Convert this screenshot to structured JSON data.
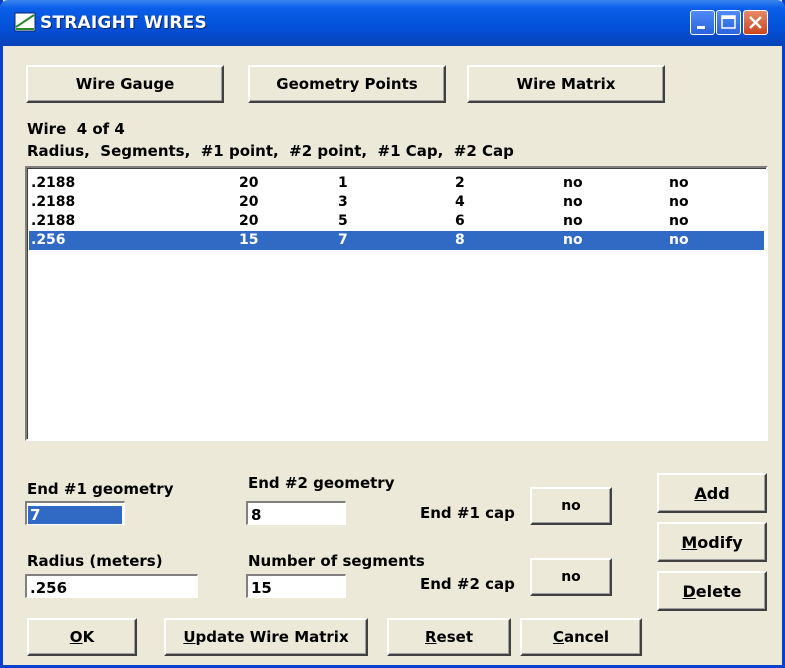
{
  "window": {
    "title": "STRAIGHT WIRES"
  },
  "top_buttons": {
    "wire_gauge": "Wire Gauge",
    "geometry_points": "Geometry Points",
    "wire_matrix": "Wire Matrix"
  },
  "wire_counter": "Wire  4 of 4",
  "list_header": "Radius,  Segments,  #1 point,  #2 point,  #1 Cap,  #2 Cap",
  "wires": [
    {
      "radius": ".2188",
      "segments": "20",
      "p1": "1",
      "p2": "2",
      "cap1": "no",
      "cap2": "no"
    },
    {
      "radius": ".2188",
      "segments": "20",
      "p1": "3",
      "p2": "4",
      "cap1": "no",
      "cap2": "no"
    },
    {
      "radius": ".2188",
      "segments": "20",
      "p1": "5",
      "p2": "6",
      "cap1": "no",
      "cap2": "no"
    },
    {
      "radius": ".256",
      "segments": "15",
      "p1": "7",
      "p2": "8",
      "cap1": "no",
      "cap2": "no"
    }
  ],
  "selected_row_index": 3,
  "fields": {
    "end1_geometry_label": "End #1 geometry",
    "end1_geometry_value": "7",
    "end2_geometry_label": "End #2 geometry",
    "end2_geometry_value": "8",
    "radius_label": "Radius (meters)",
    "radius_value": ".256",
    "segments_label": "Number of segments",
    "segments_value": "15",
    "end1_cap_label": "End #1 cap",
    "end1_cap_value": "no",
    "end2_cap_label": "End #2 cap",
    "end2_cap_value": "no"
  },
  "side_buttons": {
    "add": "Add",
    "modify": "Modify",
    "delete": "Delete"
  },
  "bottom_buttons": {
    "ok": "OK",
    "update_wire_matrix": "Update Wire Matrix",
    "reset": "Reset",
    "cancel": "Cancel"
  },
  "colors": {
    "title_bar": "#0a5ee8",
    "selection": "#316ac5",
    "dialog_bg": "#ece9d8"
  },
  "icons": {
    "title": "antenna-wire-icon",
    "minimize": "minimize-icon",
    "maximize": "maximize-icon",
    "close": "close-icon"
  }
}
